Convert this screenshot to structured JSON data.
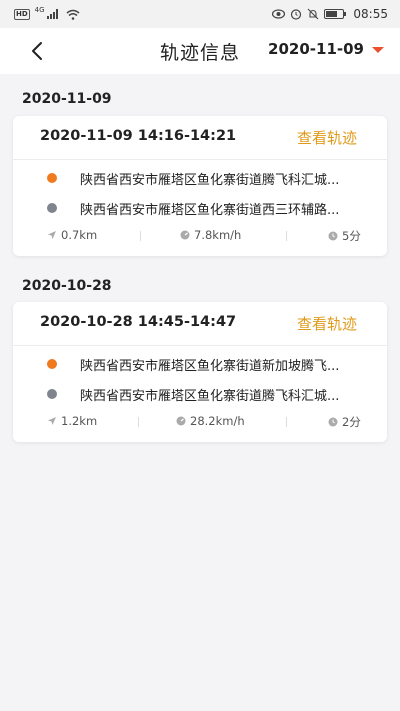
{
  "status_bar": {
    "hd": "HD",
    "network": "4G",
    "time": "08:55"
  },
  "nav": {
    "title": "轨迹信息",
    "selected_date": "2020-11-09"
  },
  "colors": {
    "accent_orange": "#e8502f",
    "link_gold": "#e09a1b",
    "start_dot": "#f07a1e",
    "end_dot": "#80848e"
  },
  "trips": [
    {
      "date": "2020-11-09",
      "time_range": "2020-11-09 14:16-14:21",
      "view_label": "查看轨迹",
      "start_address": "陕西省西安市雁塔区鱼化寨街道腾飞科汇城...",
      "end_address": "陕西省西安市雁塔区鱼化寨街道西三环辅路...",
      "distance": "0.7km",
      "speed": "7.8km/h",
      "duration": "5分"
    },
    {
      "date": "2020-10-28",
      "time_range": "2020-10-28 14:45-14:47",
      "view_label": "查看轨迹",
      "start_address": "陕西省西安市雁塔区鱼化寨街道新加坡腾飞...",
      "end_address": "陕西省西安市雁塔区鱼化寨街道腾飞科汇城...",
      "distance": "1.2km",
      "speed": "28.2km/h",
      "duration": "2分"
    }
  ]
}
